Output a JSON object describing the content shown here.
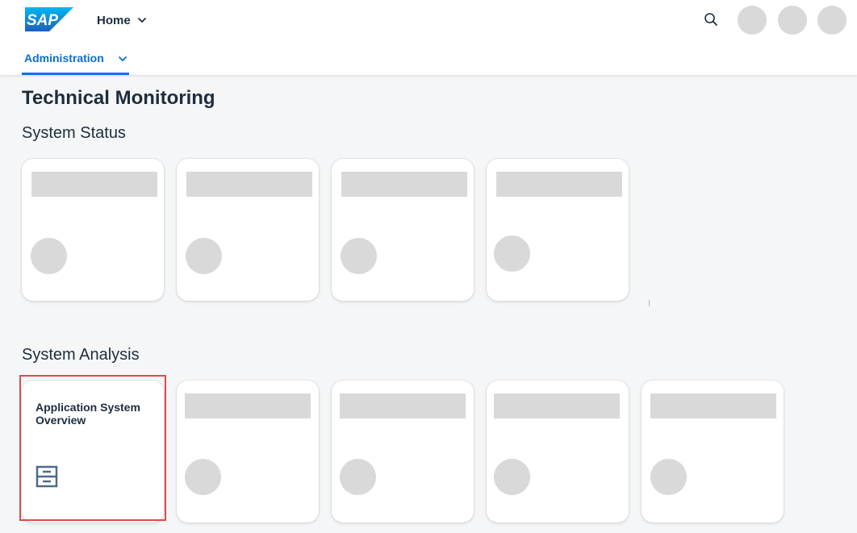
{
  "shell": {
    "logo_text": "SAP",
    "home_label": "Home",
    "icons": {
      "logo": "sap-logo",
      "chevron": "chevron-down-icon",
      "search": "search-icon"
    },
    "avatar_count": 3
  },
  "nav": {
    "active_tab": "Administration"
  },
  "page": {
    "title": "Technical Monitoring"
  },
  "sections": [
    {
      "title": "System Status",
      "tiles": [
        {
          "title": "",
          "loading": true
        },
        {
          "title": "",
          "loading": true
        },
        {
          "title": "",
          "loading": true
        },
        {
          "title": "",
          "loading": true
        }
      ]
    },
    {
      "title": "System Analysis",
      "tiles": [
        {
          "title": "Application System Overview",
          "icon": "server-icon",
          "loading": false,
          "highlighted": true
        },
        {
          "title": "",
          "loading": true
        },
        {
          "title": "",
          "loading": true
        },
        {
          "title": "",
          "loading": true
        },
        {
          "title": "",
          "loading": true
        }
      ]
    }
  ],
  "colors": {
    "accent": "#0070f2",
    "highlight": "#e04a4a",
    "placeholder": "#d9d9d9",
    "background": "#f5f6f7",
    "text": "#1d2d3e"
  }
}
